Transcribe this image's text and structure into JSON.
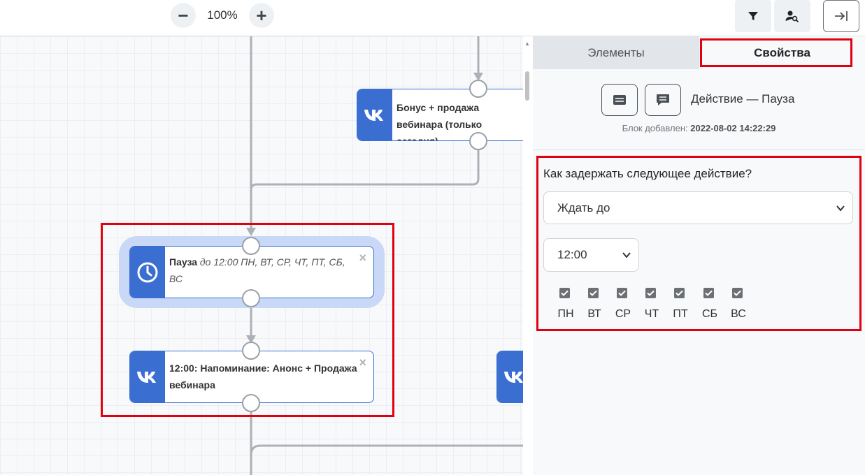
{
  "toolbar": {
    "zoom_out_label": "−",
    "zoom_level": "100%",
    "zoom_in_label": "+"
  },
  "canvas": {
    "nodes": [
      {
        "title": "Бонус + продажа вебинара (только сегодня)",
        "icon": "vk-icon"
      },
      {
        "title": "Пауза",
        "detail": "до 12:00 ПН, ВТ, СР, ЧТ, ПТ, СБ, ВС",
        "icon": "clock-icon",
        "close": "×"
      },
      {
        "title": "12:00: Напоминание: Анонс + Продажа вебинара",
        "icon": "vk-icon",
        "close": "×"
      }
    ]
  },
  "panel": {
    "tabs": [
      "Элементы",
      "Свойства"
    ],
    "active_tab": "Свойства",
    "action_title": "Действие — Пауза",
    "added_label": "Блок добавлен:",
    "added_value": "2022-08-02 14:22:29",
    "question": "Как задержать следующее действие?",
    "delay_mode": "Ждать до",
    "time_value": "12:00",
    "days": [
      {
        "label": "ПН",
        "checked": true
      },
      {
        "label": "ВТ",
        "checked": true
      },
      {
        "label": "СР",
        "checked": true
      },
      {
        "label": "ЧТ",
        "checked": true
      },
      {
        "label": "ПТ",
        "checked": true
      },
      {
        "label": "СБ",
        "checked": true
      },
      {
        "label": "ВС",
        "checked": true
      }
    ]
  },
  "colors": {
    "accent": "#3b6ed1",
    "highlight": "#e00012",
    "selected_halo": "#c9d8f7"
  }
}
